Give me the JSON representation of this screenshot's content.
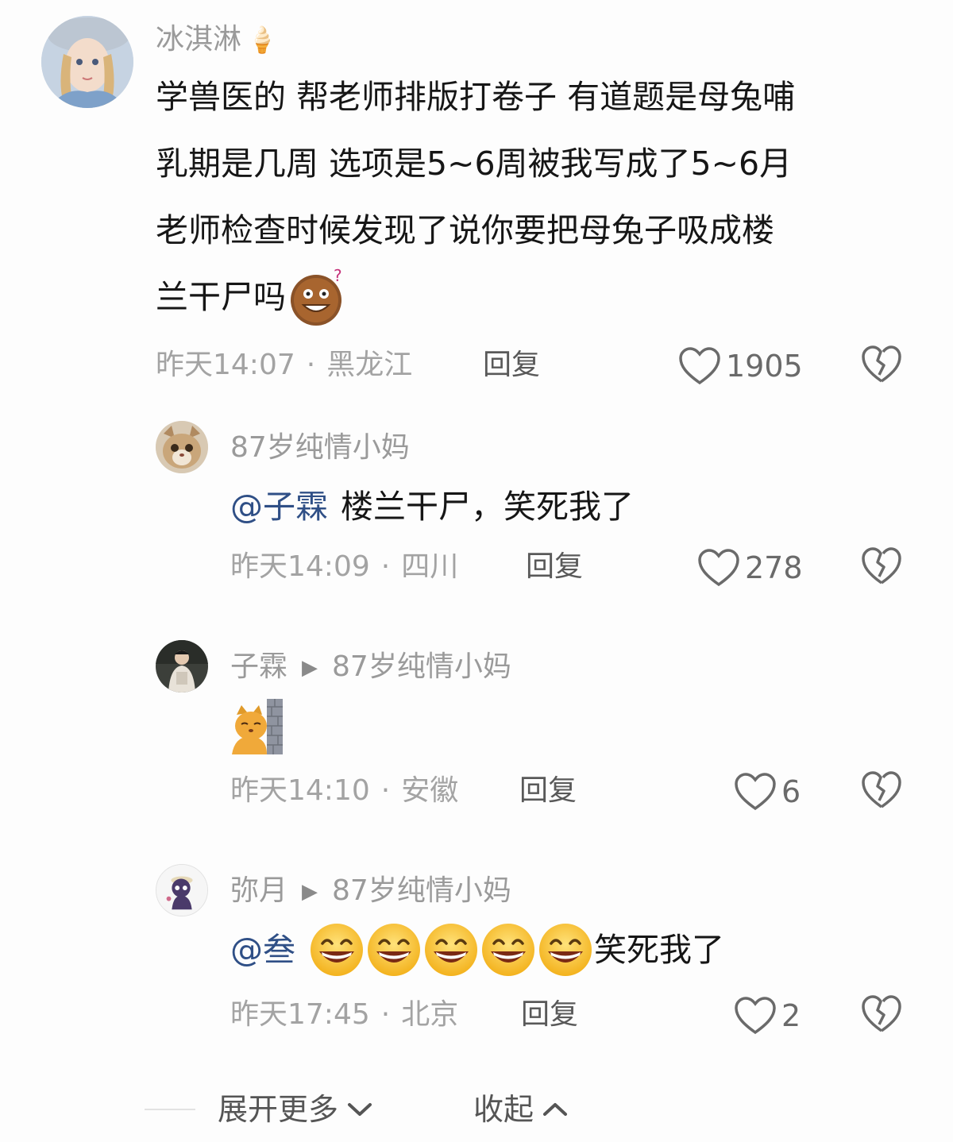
{
  "comments": [
    {
      "username": "冰淇淋",
      "username_emoji": "🍦",
      "lines": [
        "学兽医的 帮老师排版打卷子 有道题是母兔哺",
        "乳期是几周 选项是5~6周被我写成了5~6月",
        "老师检查时候发现了说你要把母兔子吸成楼",
        "兰干尸吗"
      ],
      "time": "昨天14:07",
      "location": "黑龙江",
      "reply_label": "回复",
      "likes": "1905"
    },
    {
      "username": "87岁纯情小妈",
      "mention": "@子霖",
      "text": "楼兰干尸，笑死我了",
      "time": "昨天14:09",
      "location": "四川",
      "reply_label": "回复",
      "likes": "278"
    },
    {
      "username": "子霖",
      "reply_to": "87岁纯情小妈",
      "sticker": "cat-peeking-sticker",
      "time": "昨天14:10",
      "location": "安徽",
      "reply_label": "回复",
      "likes": "6"
    },
    {
      "username": "弥月",
      "reply_to": "87岁纯情小妈",
      "mention": "@叁",
      "text": "笑死我了",
      "time": "昨天17:45",
      "location": "北京",
      "reply_label": "回复",
      "likes": "2"
    }
  ],
  "footer": {
    "expand_label": "展开更多",
    "collapse_label": "收起"
  },
  "dot": "·"
}
